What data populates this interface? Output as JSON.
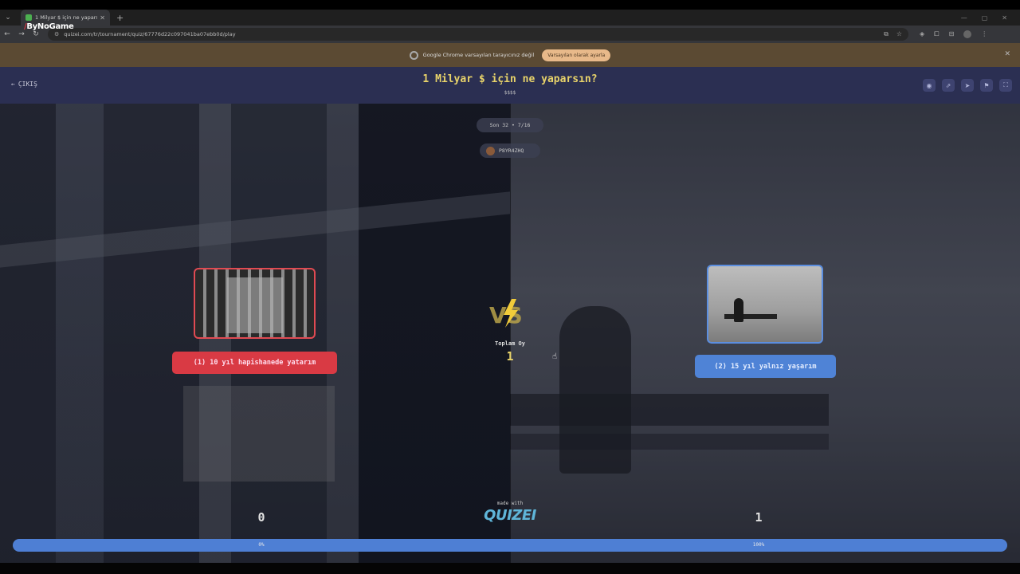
{
  "watermark": "ByNoGame",
  "browser": {
    "tab_title": "1 Milyar $ için ne yaparsın? - T",
    "url": "quizei.com/tr/tournament/quiz/67776d22c097041ba07ebb0d/play",
    "infobar_text": "Google Chrome varsayılan tarayıcınız değil",
    "infobar_button": "Varsayılan olarak ayarla"
  },
  "quiz": {
    "exit_label": "ÇIKIŞ",
    "title": "1 Milyar $ için ne yaparsın?",
    "subtitle": "$$$$",
    "round": "Son 32 • 7/16",
    "username": "P8YR4ZHQ",
    "total_label": "Toplam Oy",
    "total_value": "1",
    "vs_text": "VS",
    "made_with": "made with",
    "logo": "QUIZEI"
  },
  "options": [
    {
      "label": "(1) 10 yıl hapishanede yatarım",
      "votes": "0",
      "percent": "0%",
      "accent": "#d93a44"
    },
    {
      "label": "(2) 15 yıl yalnız yaşarım",
      "votes": "1",
      "percent": "100%",
      "accent": "#4f83d6"
    }
  ],
  "progress": {
    "left_fraction": 0.0,
    "right_fraction": 1.0
  },
  "header_icons": [
    "eye-icon",
    "share-icon",
    "send-icon",
    "flag-icon",
    "fullscreen-icon"
  ]
}
